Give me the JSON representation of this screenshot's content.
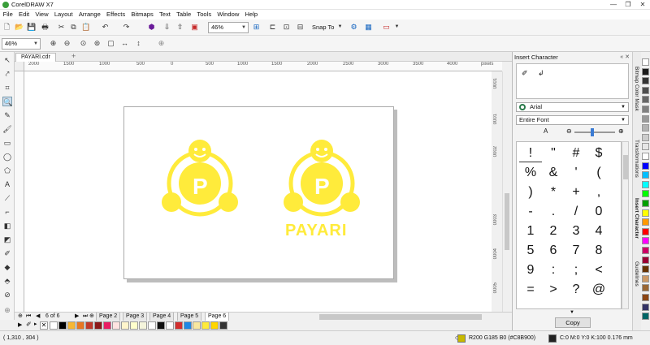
{
  "app": {
    "title": "CorelDRAW X7"
  },
  "menu": [
    "File",
    "Edit",
    "View",
    "Layout",
    "Arrange",
    "Effects",
    "Bitmaps",
    "Text",
    "Table",
    "Tools",
    "Window",
    "Help"
  ],
  "toolbar": {
    "zoom_value": "46%",
    "snap_label": "Snap To"
  },
  "propbar": {
    "zoom_value": "46%"
  },
  "document": {
    "tab_name": "PAYARI.cdr"
  },
  "ruler": {
    "h_labels": [
      "2000",
      "1500",
      "1000",
      "500",
      "0",
      "500",
      "1000",
      "1500",
      "2000",
      "2500",
      "3000",
      "3500",
      "4000",
      "4500"
    ],
    "unit": "pixels",
    "v_labels": [
      "0001",
      "0001",
      "0002",
      "0003",
      "0004",
      "0005"
    ]
  },
  "artwork": {
    "text": "PAYARI",
    "color": "#FFEB3B"
  },
  "pages": {
    "counter": "6 of 6",
    "tabs": [
      "Page 2",
      "Page 3",
      "Page 4",
      "Page 5",
      "Page 6"
    ],
    "active": "Page 6"
  },
  "swatches": [
    "#FFFFFF",
    "#000000",
    "#F7B733",
    "#E87722",
    "#C0392B",
    "#8B1A1A",
    "#E91E63",
    "#FFE4E1",
    "#FFF5CC",
    "#FFFFCC",
    "#F5F5DC",
    "#FFFFFF",
    "#111111",
    "#FFFFFF",
    "#D32F2F",
    "#1E88E5",
    "#F9E79F",
    "#FFEB3B",
    "#FFD600",
    "#333333"
  ],
  "status": {
    "coords": "( 1,310 , 304 )",
    "fill_info": "R200 G185 B0 (#C8B900)",
    "outline_info": "C:0 M:0 Y:0 K:100  0.176 mm",
    "fill_color": "#C8B900",
    "outline_color": "#222222"
  },
  "docker": {
    "title": "Insert Character",
    "font": "Arial",
    "range": "Entire Font",
    "characters": [
      "!",
      "\"",
      "#",
      "$",
      "%",
      "&",
      "'",
      "(",
      ")",
      "*",
      "+",
      ",",
      "-",
      ".",
      "/",
      "0",
      "1",
      "2",
      "3",
      "4",
      "5",
      "6",
      "7",
      "8",
      "9",
      ":",
      ";",
      "<",
      "=",
      ">",
      "?",
      "@"
    ],
    "copy_label": "Copy",
    "side_tabs": [
      "Bitmap Color Mask",
      "Transformations",
      "Insert Character",
      "Guidelines"
    ]
  },
  "palette_colors": [
    "#FFFFFF",
    "#1a1a1a",
    "#333333",
    "#4d4d4d",
    "#666666",
    "#808080",
    "#999999",
    "#b3b3b3",
    "#cccccc",
    "#e6e6e6",
    "#ffffff",
    "#0000ff",
    "#00bfff",
    "#00ffff",
    "#00ff00",
    "#00a000",
    "#ffff00",
    "#ff9900",
    "#ff0000",
    "#ff00ff",
    "#cc0066",
    "#990033",
    "#663300",
    "#cc9966",
    "#996633",
    "#8b4513",
    "#333366",
    "#006666"
  ]
}
